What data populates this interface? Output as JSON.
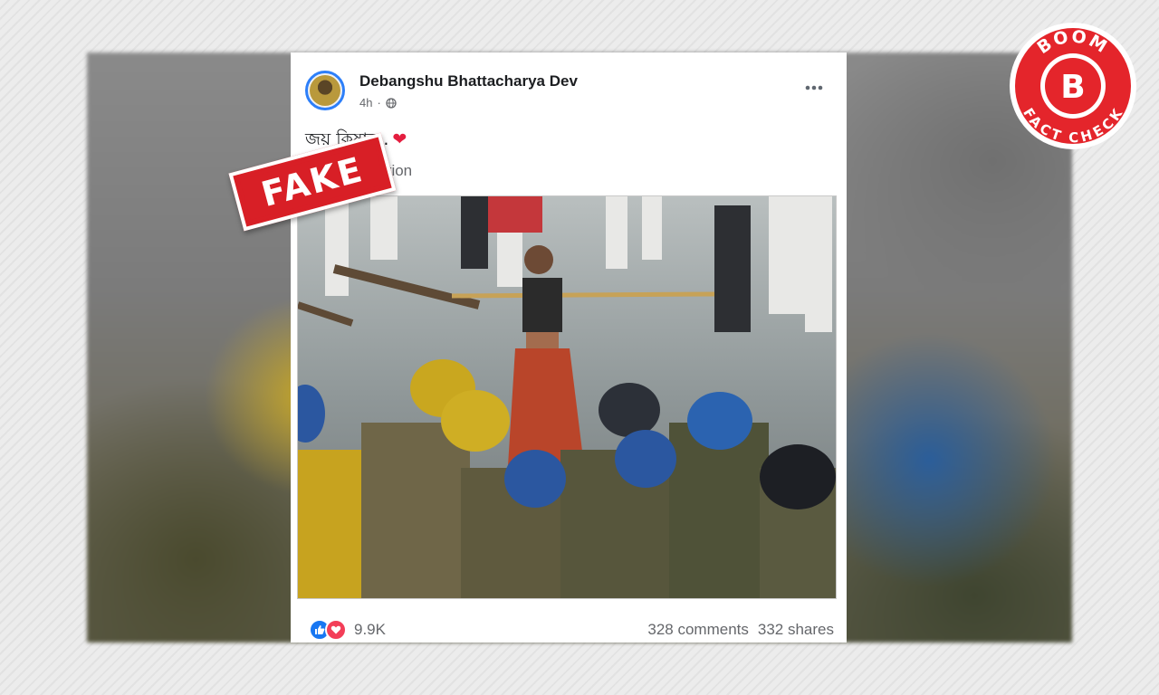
{
  "post": {
    "author": "Debangshu Bhattacharya Dev",
    "time": "4h",
    "text": "জয় কিষান..",
    "emoji": "❤",
    "see_translation": "See Translation",
    "reactions_count": "9.9K",
    "comments": "328 comments",
    "shares": "332 shares"
  },
  "overlay": {
    "fake_label": "FAKE"
  },
  "badge": {
    "top_text": "BOOM",
    "letter": "B",
    "bottom_text": "FACT CHECK"
  },
  "icons": {
    "globe": "globe-icon",
    "more": "more-options-icon",
    "like": "like-reaction-icon",
    "love": "love-reaction-icon"
  },
  "colors": {
    "fake_red": "#d81f26",
    "boom_red": "#e4252b",
    "fb_blue": "#1877f2"
  }
}
